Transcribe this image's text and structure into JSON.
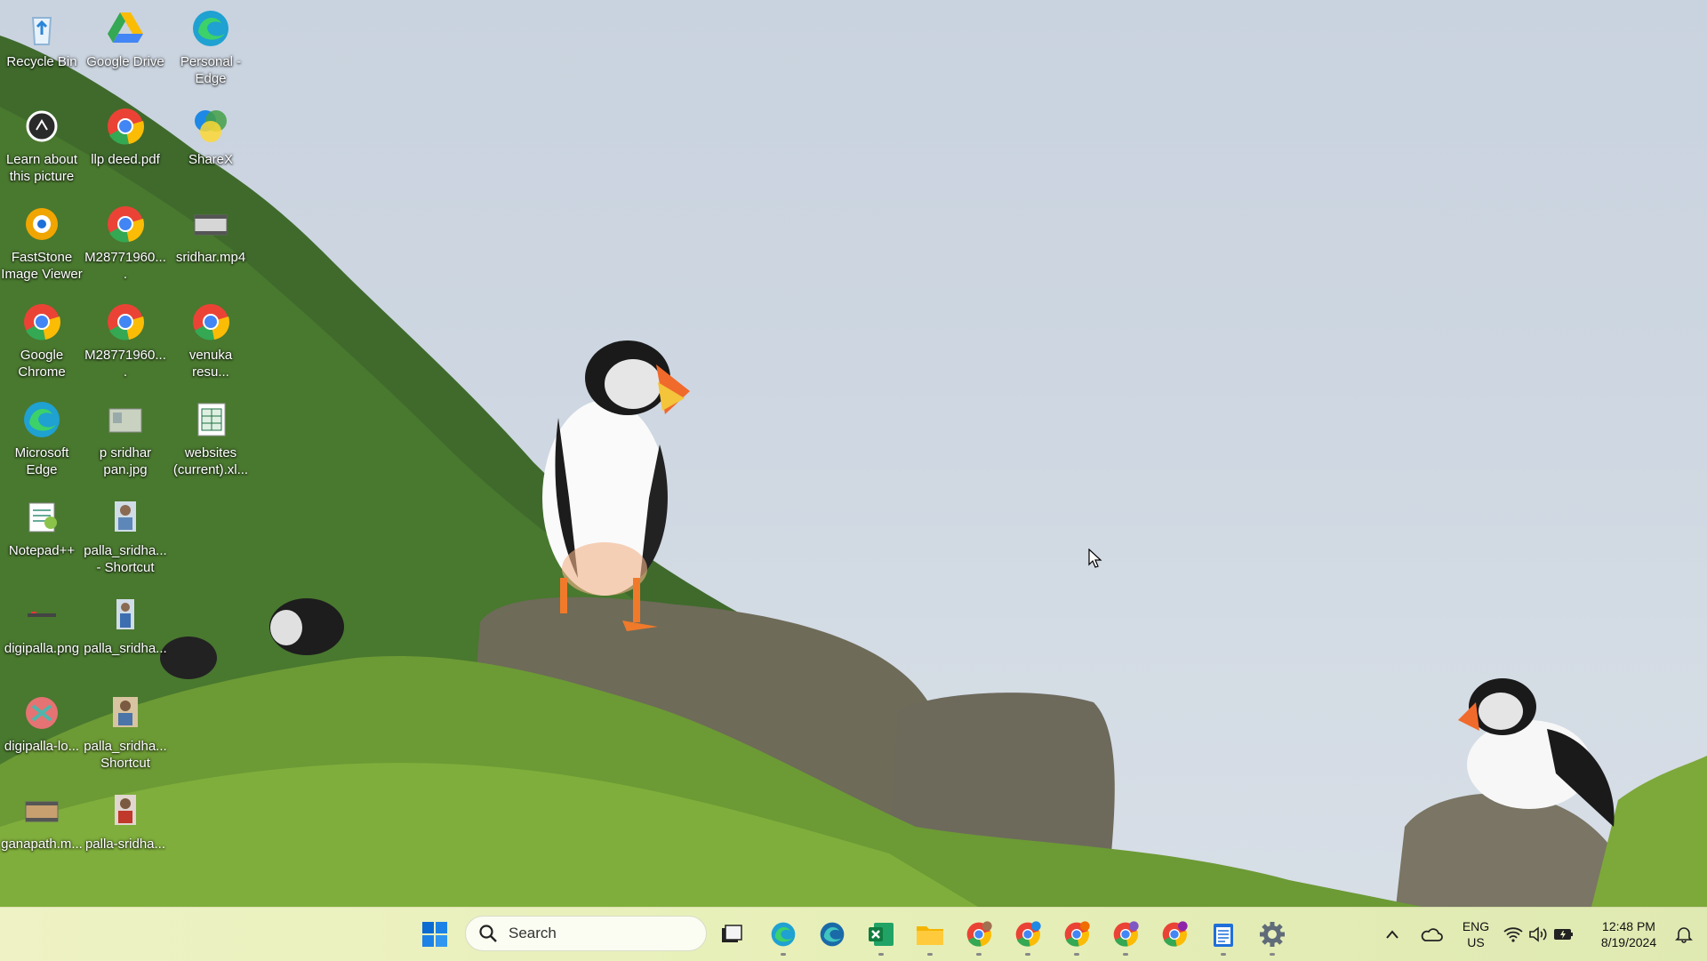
{
  "desktop": {
    "icons": [
      {
        "name": "recycle-bin",
        "label": "Recycle Bin"
      },
      {
        "name": "google-drive",
        "label": "Google Drive"
      },
      {
        "name": "personal-edge",
        "label": "Personal - Edge"
      },
      {
        "name": "learn-about-picture",
        "label": "Learn about this picture"
      },
      {
        "name": "llp-deed",
        "label": "llp deed.pdf"
      },
      {
        "name": "sharex",
        "label": "ShareX"
      },
      {
        "name": "faststone",
        "label": "FastStone Image Viewer"
      },
      {
        "name": "m2877-1",
        "label": "M28771960...."
      },
      {
        "name": "sridhar-mp4",
        "label": "sridhar.mp4"
      },
      {
        "name": "google-chrome",
        "label": "Google Chrome"
      },
      {
        "name": "m2877-2",
        "label": "M28771960...."
      },
      {
        "name": "venuka",
        "label": "venuka resu..."
      },
      {
        "name": "microsoft-edge",
        "label": "Microsoft Edge"
      },
      {
        "name": "p-sridhar-pan",
        "label": "p sridhar pan.jpg"
      },
      {
        "name": "websites",
        "label": "websites (current).xl..."
      },
      {
        "name": "notepadpp",
        "label": "Notepad++"
      },
      {
        "name": "palla-shortcut-1",
        "label": "palla_sridha... - Shortcut"
      },
      {
        "name": "digipalla-png",
        "label": "digipalla.png"
      },
      {
        "name": "palla-sridha",
        "label": "palla_sridha..."
      },
      {
        "name": "digipalla-lo",
        "label": "digipalla-lo..."
      },
      {
        "name": "palla-shortcut-2",
        "label": "palla_sridha... Shortcut"
      },
      {
        "name": "ganapath",
        "label": "ganapath.m..."
      },
      {
        "name": "palla-sridha-2",
        "label": "palla-sridha..."
      }
    ]
  },
  "taskbar": {
    "search_placeholder": "Search",
    "lang_top": "ENG",
    "lang_bottom": "US",
    "time": "12:48 PM",
    "date": "8/19/2024",
    "apps": [
      "start",
      "search",
      "task-view",
      "edge",
      "edge-dev",
      "excel",
      "file-explorer",
      "chrome-profile-1",
      "chrome-profile-2",
      "chrome-profile-3",
      "chrome-profile-4",
      "chrome-profile-5",
      "notepad",
      "settings"
    ]
  },
  "colors": {
    "chrome_red": "#ea4335",
    "chrome_green": "#34a853",
    "chrome_yellow": "#fbbc05",
    "chrome_blue": "#4285f4",
    "excel_green": "#1d6f42",
    "windows_blue": "#0078d4"
  }
}
